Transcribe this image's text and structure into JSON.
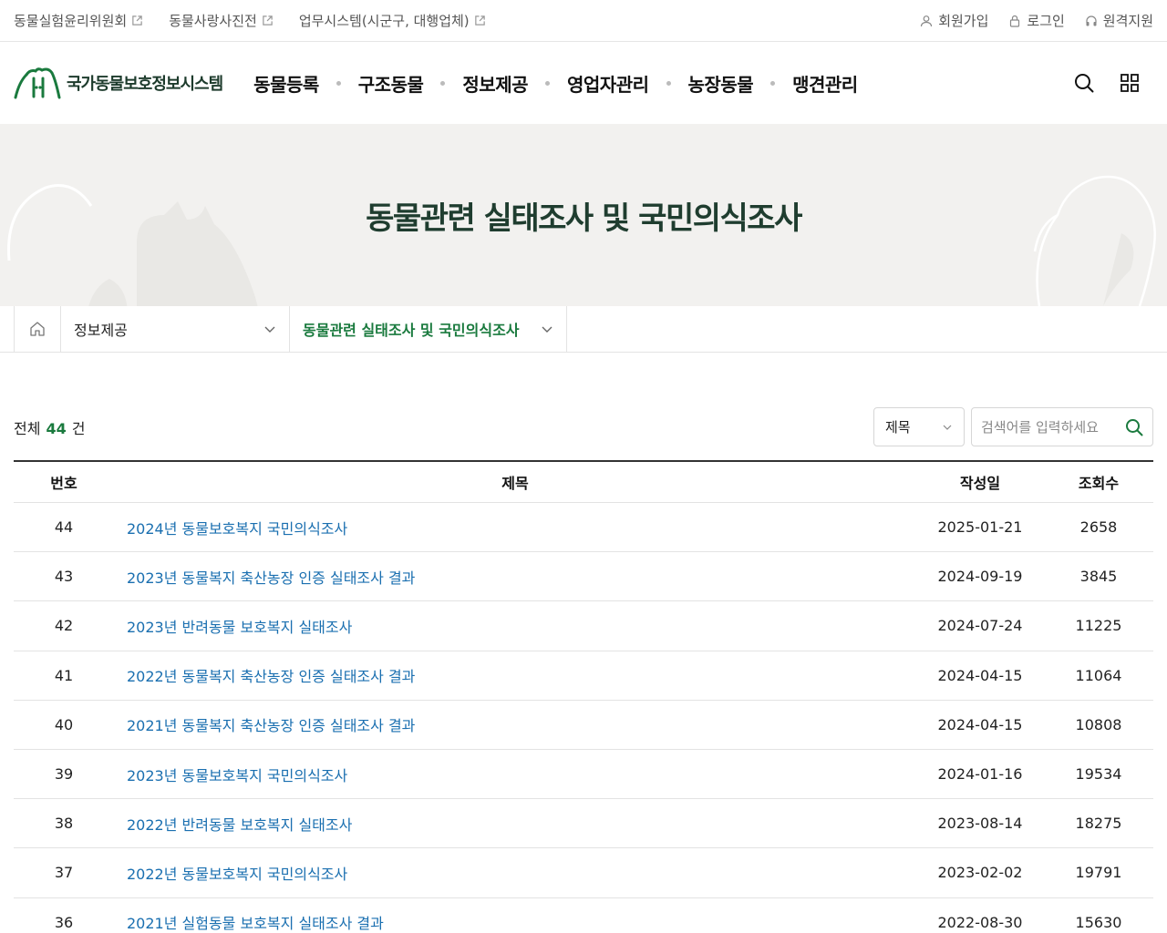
{
  "utility": {
    "links_left": [
      {
        "label": "동물실험윤리위원회"
      },
      {
        "label": "동물사랑사진전"
      },
      {
        "label": "업무시스템(시군구, 대행업체)"
      }
    ],
    "links_right": [
      {
        "label": "회원가입",
        "icon": "user-icon"
      },
      {
        "label": "로그인",
        "icon": "lock-icon"
      },
      {
        "label": "원격지원",
        "icon": "headset-icon"
      }
    ]
  },
  "header": {
    "logo_text": "국가동물보호정보시스템",
    "nav": [
      "동물등록",
      "구조동물",
      "정보제공",
      "영업자관리",
      "농장동물",
      "맹견관리"
    ]
  },
  "banner": {
    "title": "동물관련 실태조사 및 국민의식조사"
  },
  "breadcrumb": {
    "level1": "정보제공",
    "level2": "동물관련 실태조사 및 국민의식조사"
  },
  "list": {
    "total_prefix": "전체",
    "total_count": "44",
    "total_suffix": "건",
    "search_field": "제목",
    "search_placeholder": "검색어를 입력하세요",
    "columns": {
      "no": "번호",
      "title": "제목",
      "date": "작성일",
      "views": "조회수"
    },
    "rows": [
      {
        "no": "44",
        "title": "2024년 동물보호복지 국민의식조사",
        "date": "2025-01-21",
        "views": "2658"
      },
      {
        "no": "43",
        "title": "2023년 동물복지 축산농장 인증 실태조사 결과",
        "date": "2024-09-19",
        "views": "3845"
      },
      {
        "no": "42",
        "title": "2023년 반려동물 보호복지 실태조사",
        "date": "2024-07-24",
        "views": "11225"
      },
      {
        "no": "41",
        "title": "2022년 동물복지 축산농장 인증 실태조사 결과",
        "date": "2024-04-15",
        "views": "11064"
      },
      {
        "no": "40",
        "title": "2021년 동물복지 축산농장 인증 실태조사 결과",
        "date": "2024-04-15",
        "views": "10808"
      },
      {
        "no": "39",
        "title": "2023년 동물보호복지 국민의식조사",
        "date": "2024-01-16",
        "views": "19534"
      },
      {
        "no": "38",
        "title": "2022년 반려동물 보호복지 실태조사",
        "date": "2023-08-14",
        "views": "18275"
      },
      {
        "no": "37",
        "title": "2022년 동물보호복지 국민의식조사",
        "date": "2023-02-02",
        "views": "19791"
      },
      {
        "no": "36",
        "title": "2021년 실험동물 보호복지 실태조사 결과",
        "date": "2022-08-30",
        "views": "15630"
      }
    ]
  },
  "colors": {
    "accent": "#1a7a3e",
    "link": "#1a6fb0",
    "banner_bg": "#f2f1ef",
    "title_dark": "#1f3d2f"
  }
}
